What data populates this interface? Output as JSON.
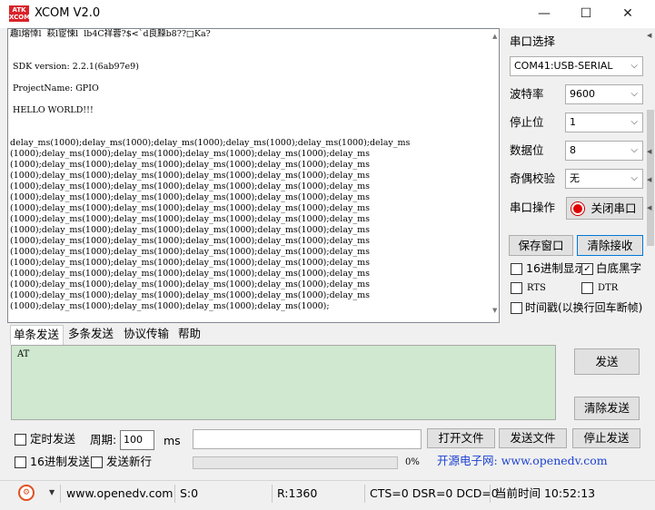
{
  "window": {
    "logo_text": "ATK XCOM",
    "title": "XCOM V2.0",
    "min_glyph": "—",
    "max_glyph": "☐",
    "close_glyph": "✕"
  },
  "receive": {
    "text": "趣l熔悻l  萩l宦悚l  lb4C祥蓉?$<`d良䵲b8??□Ka?\n\n\n SDK version: 2.2.1(6ab97e9)\n\n ProjectName: GPIO\n\n HELLO WORLD!!!\n\n\ndelay_ms(1000);delay_ms(1000);delay_ms(1000);delay_ms(1000);delay_ms(1000);delay_ms\n(1000);delay_ms(1000);delay_ms(1000);delay_ms(1000);delay_ms(1000);delay_ms\n(1000);delay_ms(1000);delay_ms(1000);delay_ms(1000);delay_ms(1000);delay_ms\n(1000);delay_ms(1000);delay_ms(1000);delay_ms(1000);delay_ms(1000);delay_ms\n(1000);delay_ms(1000);delay_ms(1000);delay_ms(1000);delay_ms(1000);delay_ms\n(1000);delay_ms(1000);delay_ms(1000);delay_ms(1000);delay_ms(1000);delay_ms\n(1000);delay_ms(1000);delay_ms(1000);delay_ms(1000);delay_ms(1000);delay_ms\n(1000);delay_ms(1000);delay_ms(1000);delay_ms(1000);delay_ms(1000);delay_ms\n(1000);delay_ms(1000);delay_ms(1000);delay_ms(1000);delay_ms(1000);delay_ms\n(1000);delay_ms(1000);delay_ms(1000);delay_ms(1000);delay_ms(1000);delay_ms\n(1000);delay_ms(1000);delay_ms(1000);delay_ms(1000);delay_ms(1000);delay_ms\n(1000);delay_ms(1000);delay_ms(1000);delay_ms(1000);delay_ms(1000);delay_ms\n(1000);delay_ms(1000);delay_ms(1000);delay_ms(1000);delay_ms(1000);delay_ms\n(1000);delay_ms(1000);delay_ms(1000);delay_ms(1000);delay_ms(1000);delay_ms\n(1000);delay_ms(1000);delay_ms(1000);delay_ms(1000);delay_ms(1000);delay_ms\n(1000);delay_ms(1000);delay_ms(1000);delay_ms(1000);delay_ms(1000);"
  },
  "serial": {
    "port_label": "串口选择",
    "port_value": "COM41:USB-SERIAL",
    "baud_label": "波特率",
    "baud_value": "9600",
    "stop_label": "停止位",
    "stop_value": "1",
    "data_label": "数据位",
    "data_value": "8",
    "parity_label": "奇偶校验",
    "parity_value": "无",
    "op_label": "串口操作",
    "close_port_label": "关闭串口"
  },
  "recv_controls": {
    "save_window": "保存窗口",
    "clear_recv": "清除接收",
    "hex_display": "16进制显示",
    "white_bg": "白底黑字",
    "white_bg_check": "✓",
    "rts": "RTS",
    "dtr": "DTR",
    "timestamp": "时间戳(以换行回车断帧)"
  },
  "tabs": {
    "single": "单条发送",
    "multi": "多条发送",
    "protocol": "协议传输",
    "help": "帮助"
  },
  "send": {
    "text": "AT",
    "send_button": "发送",
    "clear_send": "清除发送"
  },
  "bottom": {
    "timed_send": "定时发送",
    "period_label": "周期:",
    "period_value": "100",
    "period_unit": "ms",
    "hex_send": "16进制发送",
    "send_newline": "发送新行",
    "progress_text": "0%",
    "open_file": "打开文件",
    "send_file": "发送文件",
    "stop_send": "停止发送",
    "promo": "开源电子网: www.openedv.com"
  },
  "status": {
    "url": "www.openedv.com",
    "sent": "S:0",
    "received": "R:1360",
    "lines": "CTS=0 DSR=0 DCD=0",
    "time": "当前时间 10:52:13",
    "gear_glyph": "⚙",
    "dropdown_glyph": "▼"
  },
  "colors": {
    "send_area_bg": "#cfe8cf",
    "promo_text": "#1a3fd0",
    "close_port_dot": "#e00000"
  }
}
